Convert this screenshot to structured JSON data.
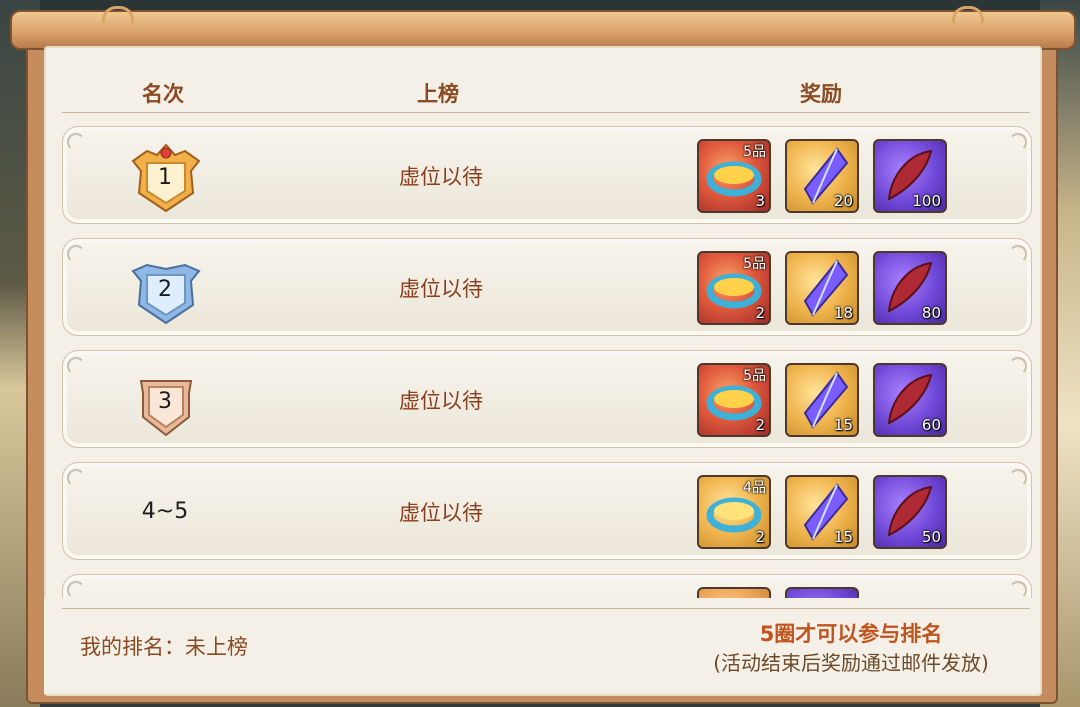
{
  "headers": {
    "rank": "名次",
    "listed": "上榜",
    "reward": "奖励"
  },
  "rows": [
    {
      "rank": "1",
      "medal": "gold",
      "status": "虚位以待",
      "rewards": [
        {
          "icon": "ring-icon",
          "grade": "5品",
          "count": "3"
        },
        {
          "icon": "crystal-icon",
          "count": "20"
        },
        {
          "icon": "feather-icon",
          "count": "100"
        }
      ]
    },
    {
      "rank": "2",
      "medal": "silver",
      "status": "虚位以待",
      "rewards": [
        {
          "icon": "ring-icon",
          "grade": "5品",
          "count": "2"
        },
        {
          "icon": "crystal-icon",
          "count": "18"
        },
        {
          "icon": "feather-icon",
          "count": "80"
        }
      ]
    },
    {
      "rank": "3",
      "medal": "bronze",
      "status": "虚位以待",
      "rewards": [
        {
          "icon": "ring-icon",
          "grade": "5品",
          "count": "2"
        },
        {
          "icon": "crystal-icon",
          "count": "15"
        },
        {
          "icon": "feather-icon",
          "count": "60"
        }
      ]
    },
    {
      "rank": "4~5",
      "medal": "none",
      "status": "虚位以待",
      "rewards": [
        {
          "icon": "ring-icon",
          "grade": "4品",
          "count": "2"
        },
        {
          "icon": "crystal-icon",
          "count": "15"
        },
        {
          "icon": "feather-icon",
          "count": "50"
        }
      ]
    }
  ],
  "footer": {
    "my_rank_label": "我的排名：",
    "my_rank_value": "未上榜",
    "note_main": "5圈才可以参与排名",
    "note_sub": "(活动结束后奖励通过邮件发放)"
  },
  "colors": {
    "header_text": "#8a4a22",
    "status_text": "#8a3e1c",
    "note_text": "#c0541e"
  }
}
